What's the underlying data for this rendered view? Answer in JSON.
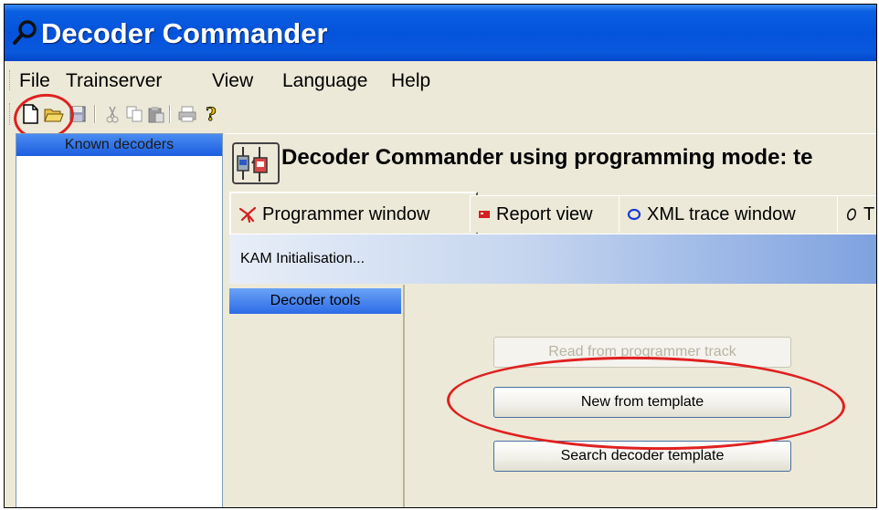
{
  "window": {
    "title": "Decoder Commander",
    "icon": "magnifier-icon"
  },
  "menu": [
    "File",
    "Trainserver",
    "View",
    "Language",
    "Help"
  ],
  "toolbar": {
    "buttons": [
      "new-icon",
      "open-icon",
      "save-icon",
      "cut-icon",
      "copy-icon",
      "paste-icon",
      "print-icon",
      "help-icon"
    ]
  },
  "left_panel": {
    "header": "Known decoders"
  },
  "header": {
    "title": "Decoder Commander using programming mode: te"
  },
  "tabs": [
    {
      "label": "Programmer window",
      "icon": "programmer-icon",
      "active": true
    },
    {
      "label": "Report view",
      "icon": "report-icon",
      "active": false
    },
    {
      "label": "XML trace window",
      "icon": "xml-trace-icon",
      "active": false
    },
    {
      "label": "T",
      "icon": "trace-icon",
      "active": false
    }
  ],
  "kam": {
    "label": "KAM Initialisation..."
  },
  "decoder_tools": {
    "header": "Decoder tools"
  },
  "actions": {
    "read": "Read from programmer track",
    "new_template": "New from template",
    "search": "Search decoder template"
  },
  "colors": {
    "title_bar": "#0453dc",
    "annotation": "#e02020",
    "panel_header": "#2d6be6"
  }
}
